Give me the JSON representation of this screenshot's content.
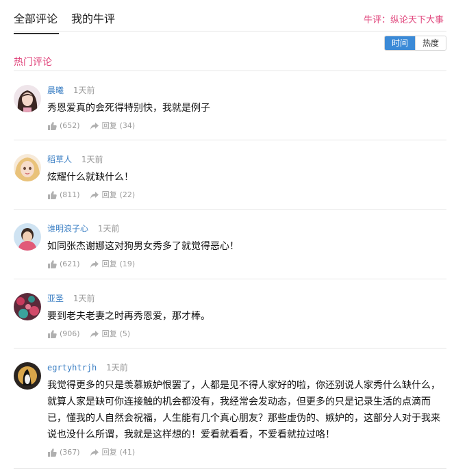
{
  "tabs": [
    {
      "label": "全部评论",
      "active": true
    },
    {
      "label": "我的牛评",
      "active": false
    }
  ],
  "top_right_link": "牛评：纵论天下大事",
  "sort": {
    "time_label": "时间",
    "hot_label": "热度"
  },
  "section_title": "热门评论",
  "colors": {
    "accent_pink": "#e0447b",
    "accent_blue": "#3b8ad7",
    "username_blue": "#3b7fc4"
  },
  "icons": {
    "like": "thumbs-up-icon",
    "reply": "reply-arrow-icon"
  },
  "comments": [
    {
      "username": "晨曦",
      "time": "1天前",
      "text": "秀恩爱真的会死得特别快，我就是例子",
      "likes": "(652)",
      "reply_label": "回复",
      "replies": "(34)"
    },
    {
      "username": "稻草人",
      "time": "1天前",
      "text": "炫耀什么就缺什么！",
      "likes": "(811)",
      "reply_label": "回复",
      "replies": "(22)"
    },
    {
      "username": "谁明浪子心",
      "time": "1天前",
      "text": "如同张杰谢娜这对狗男女秀多了就觉得恶心！",
      "likes": "(621)",
      "reply_label": "回复",
      "replies": "(19)"
    },
    {
      "username": "亚圣",
      "time": "1天前",
      "text": "要到老夫老妻之时再秀恩爱，那才棒。",
      "likes": "(906)",
      "reply_label": "回复",
      "replies": "(5)"
    },
    {
      "username": "egrtyhtrjh",
      "time": "1天前",
      "text": "我觉得更多的只是羡慕嫉妒恨罢了，人都是见不得人家好的啦，你还别说人家秀什么缺什么，就算人家是缺可你连接触的机会都没有，我经常会发动态，但更多的只是记录生活的点滴而已，懂我的人自然会祝福，人生能有几个真心朋友？那些虚伪的、嫉妒的，这部分人对于我来说也没什么所谓，我就是这样想的！爱看就看看，不爱看就拉过咯！",
      "likes": "(367)",
      "reply_label": "回复",
      "replies": "(41)"
    }
  ]
}
